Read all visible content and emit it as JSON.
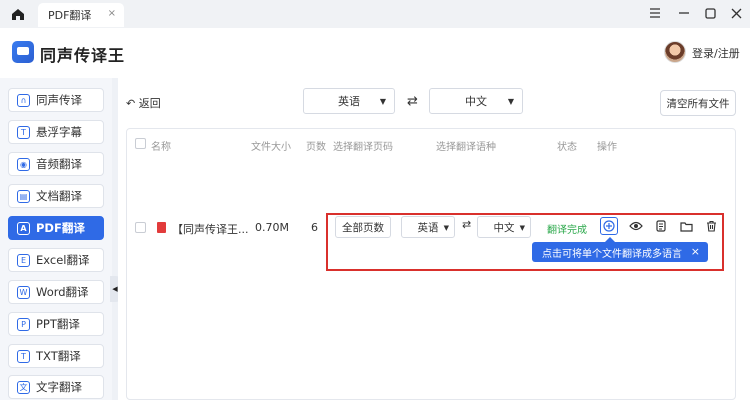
{
  "tabbar": {
    "tab_label": "PDF翻译",
    "tab_close": "×"
  },
  "header": {
    "app_title": "同声传译王",
    "login": "登录/注册"
  },
  "sidebar": {
    "items": [
      {
        "label": "同声传译",
        "icon": "headset-icon",
        "glyph": "∩"
      },
      {
        "label": "悬浮字幕",
        "icon": "subtitle-icon",
        "glyph": "T"
      },
      {
        "label": "音频翻译",
        "icon": "audio-icon",
        "glyph": "◉"
      },
      {
        "label": "文档翻译",
        "icon": "document-icon",
        "glyph": "▤"
      },
      {
        "label": "PDF翻译",
        "icon": "pdf-icon",
        "glyph": "A"
      },
      {
        "label": "Excel翻译",
        "icon": "excel-icon",
        "glyph": "E"
      },
      {
        "label": "Word翻译",
        "icon": "word-icon",
        "glyph": "W"
      },
      {
        "label": "PPT翻译",
        "icon": "ppt-icon",
        "glyph": "P"
      },
      {
        "label": "TXT翻译",
        "icon": "txt-icon",
        "glyph": "T"
      },
      {
        "label": "文字翻译",
        "icon": "text-icon",
        "glyph": "文"
      }
    ],
    "active_index": 4
  },
  "toolbar": {
    "back_label": "返回",
    "source_lang": "英语",
    "target_lang": "中文",
    "clear_label": "清空所有文件"
  },
  "table": {
    "headers": {
      "name": "名称",
      "size": "文件大小",
      "pages": "页数",
      "pages_select": "选择翻译页码",
      "lang_select": "选择翻译语种",
      "status": "状态",
      "ops": "操作"
    },
    "row": {
      "name": "【同声传译王...",
      "size": "0.70M",
      "pages": "6",
      "pages_btn": "全部页数",
      "source_lang": "英语",
      "target_lang": "中文",
      "status": "翻译完成"
    }
  },
  "tooltip": {
    "text": "点击可将单个文件翻译成多语言",
    "close": "×"
  },
  "colors": {
    "accent": "#2f6ae6",
    "success": "#2aa84a",
    "highlight_box": "#d9302c"
  }
}
